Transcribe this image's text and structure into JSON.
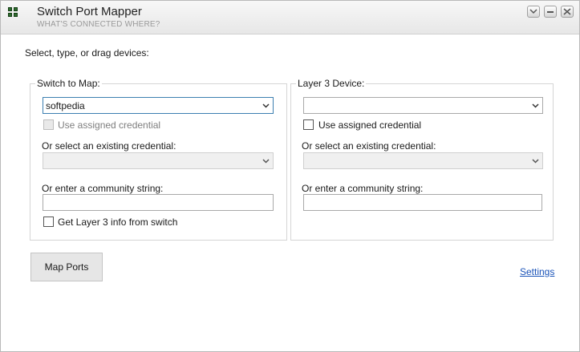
{
  "window": {
    "title": "Switch Port Mapper",
    "subtitle": "WHAT'S CONNECTED WHERE?",
    "buttons": {
      "dropdown": "chevron-down",
      "minimize": "minimize",
      "close": "close"
    }
  },
  "intro": "Select, type, or drag devices:",
  "switch_group": {
    "title": "Switch to Map:",
    "device_value": "softpedia",
    "use_credential_label": "Use assigned credential",
    "existing_credential_label": "Or select an existing credential:",
    "existing_credential_value": "",
    "community_label": "Or enter a community string:",
    "community_value": "",
    "layer3_label": "Get Layer 3 info from switch"
  },
  "layer3_group": {
    "title": "Layer 3 Device:",
    "device_value": "",
    "use_credential_label": "Use assigned credential",
    "existing_credential_label": "Or select an existing credential:",
    "existing_credential_value": "",
    "community_label": "Or enter a community string:",
    "community_value": ""
  },
  "actions": {
    "map_ports": "Map Ports",
    "settings": "Settings"
  },
  "colors": {
    "link": "#1a53b8",
    "focus_border": "#3c7fb1"
  }
}
